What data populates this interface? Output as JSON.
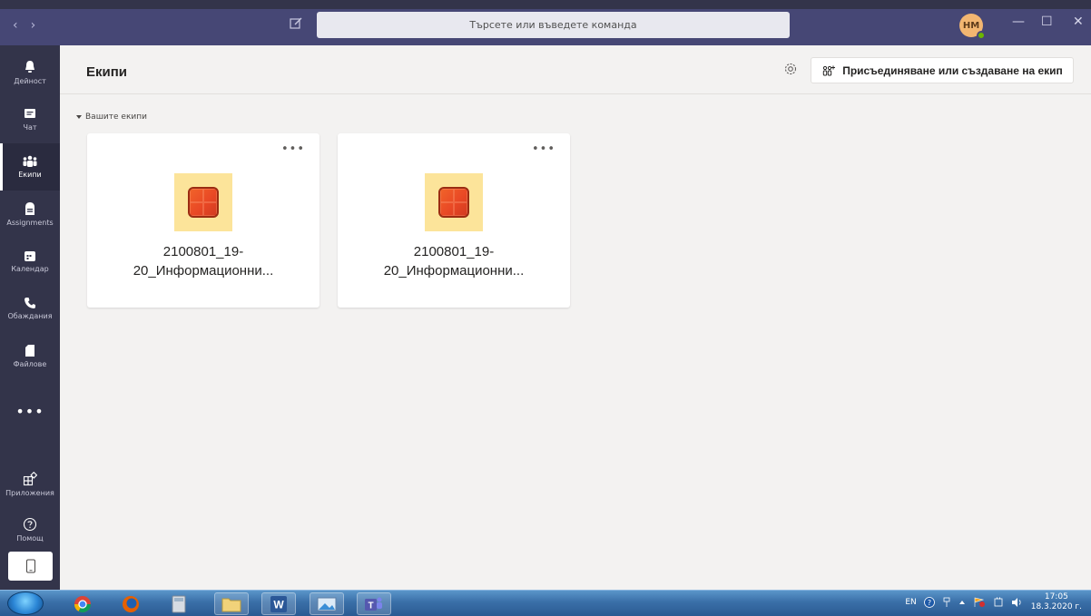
{
  "titlebar": {
    "back": "‹",
    "forward": "›",
    "search_placeholder": "Търсете или въведете команда",
    "avatar_initials": "HM",
    "minimize": "—",
    "maximize": "☐",
    "close": "✕"
  },
  "rail": {
    "items": [
      {
        "label": "Дейност",
        "icon": "bell-icon"
      },
      {
        "label": "Чат",
        "icon": "chat-icon"
      },
      {
        "label": "Екипи",
        "icon": "teams-icon"
      },
      {
        "label": "Assignments",
        "icon": "assignments-icon"
      },
      {
        "label": "Календар",
        "icon": "calendar-icon"
      },
      {
        "label": "Обаждания",
        "icon": "phone-icon"
      },
      {
        "label": "Файлове",
        "icon": "file-icon"
      }
    ],
    "more": "•••",
    "apps_label": "Приложения",
    "help_label": "Помощ"
  },
  "header": {
    "title": "Екипи",
    "join_button": "Присъединяване или създаване на екип"
  },
  "section": {
    "label": "Вашите екипи"
  },
  "teams": [
    {
      "name_line1": "2100801_19-",
      "name_line2": "20_Информационни...",
      "more": "•••"
    },
    {
      "name_line1": "2100801_19-",
      "name_line2": "20_Информационни...",
      "more": "•••"
    }
  ],
  "taskbar": {
    "lang": "EN",
    "time": "17:05",
    "date": "18.3.2020 г."
  },
  "colors": {
    "titlebar": "#464775",
    "rail": "#33344a",
    "team_tile_bg": "#fce49a",
    "team_tile_fg": "#e94825",
    "presence": "#6bb700"
  }
}
